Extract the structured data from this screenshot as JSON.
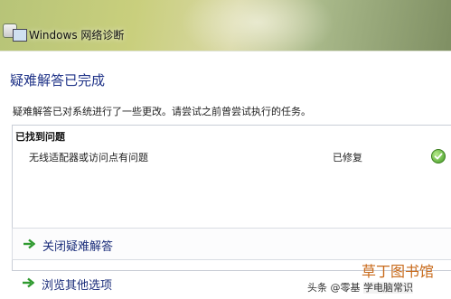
{
  "window": {
    "title": "Windows 网络诊断"
  },
  "page": {
    "heading": "疑难解答已完成",
    "description": "疑难解答已对系统进行了一些更改。请尝试之前曾尝试执行的任务。"
  },
  "results": {
    "header": "已找到问题",
    "issues": [
      {
        "description": "无线适配器或访问点有问题",
        "status": "已修复",
        "status_icon": "check-icon"
      }
    ]
  },
  "actions": {
    "close_label": "关闭疑难解答",
    "more_options_label": "浏览其他选项"
  },
  "overlay": {
    "watermark": "草丁图书馆",
    "attribution_prefix": "头条",
    "attribution_at": "@零基",
    "attribution_rest": "学电脑常识"
  },
  "colors": {
    "accent_heading": "#1e3287",
    "command_text": "#1a2c7a",
    "success_green": "#3f9a22",
    "watermark": "#c86a1a"
  }
}
